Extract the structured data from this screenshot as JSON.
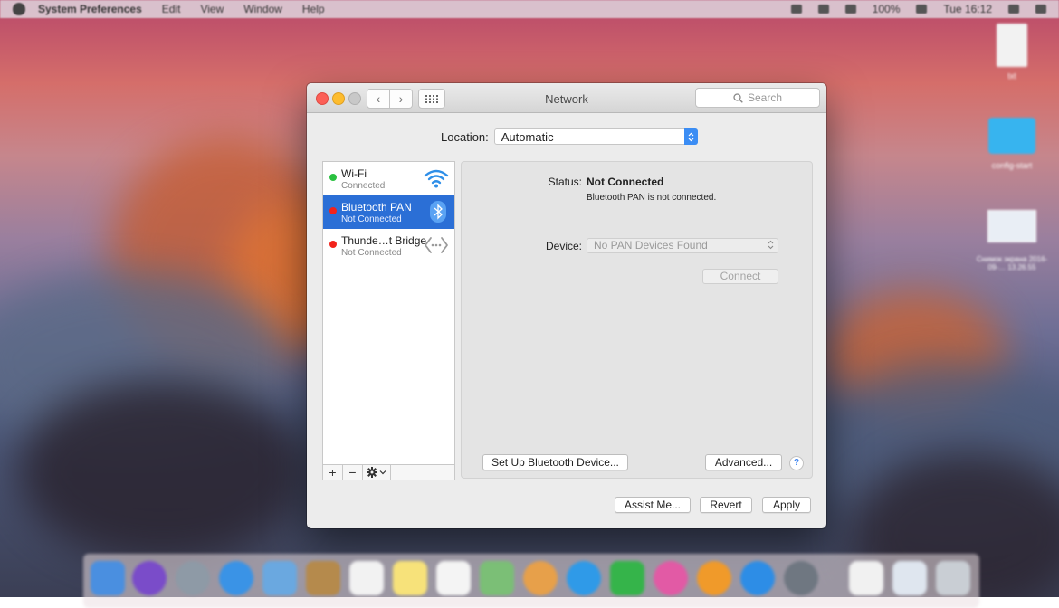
{
  "menubar": {
    "app_name": "System Preferences",
    "items": [
      "Edit",
      "View",
      "Window",
      "Help"
    ],
    "battery": "100%",
    "clock": "Tue 16:12"
  },
  "desktop_icons": [
    {
      "label": "txt",
      "icon": "document-icon"
    },
    {
      "label": "config-start",
      "icon": "folder-icon"
    },
    {
      "label": "Снимок экрана 2016-09-… 13.26.55",
      "icon": "screenshot-icon"
    }
  ],
  "window": {
    "title": "Network",
    "search_placeholder": "Search",
    "back_label": "‹",
    "forward_label": "›"
  },
  "location": {
    "label": "Location:",
    "value": "Automatic"
  },
  "services": [
    {
      "name": "Wi-Fi",
      "status": "Connected",
      "status_color": "#2ac140",
      "icon": "wifi-icon",
      "selected": false
    },
    {
      "name": "Bluetooth PAN",
      "status": "Not Connected",
      "status_color": "#f2231c",
      "icon": "bluetooth-icon",
      "selected": true
    },
    {
      "name": "Thunde…t Bridge",
      "status": "Not Connected",
      "status_color": "#f2231c",
      "icon": "thunderbolt-bridge-icon",
      "selected": false
    }
  ],
  "service_toolbar": {
    "add_label": "+",
    "remove_label": "−"
  },
  "detail": {
    "status_label": "Status:",
    "status_value": "Not Connected",
    "status_description": "Bluetooth PAN is not connected.",
    "device_label": "Device:",
    "device_value": "No PAN Devices Found",
    "connect_label": "Connect",
    "setup_label": "Set Up Bluetooth Device...",
    "advanced_label": "Advanced...",
    "help_label": "?"
  },
  "footer": {
    "assist_label": "Assist Me...",
    "revert_label": "Revert",
    "apply_label": "Apply"
  },
  "colors": {
    "accent": "#3b8df4",
    "selection": "#2b6fd6",
    "connected": "#2ac140",
    "not_connected": "#f2231c"
  }
}
